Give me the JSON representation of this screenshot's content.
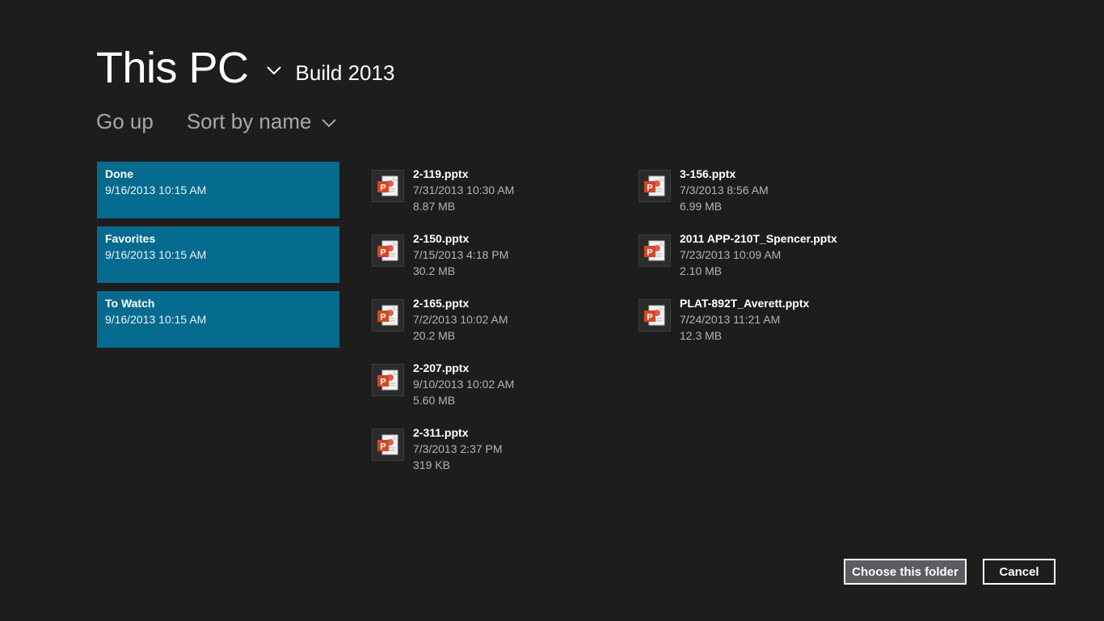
{
  "header": {
    "location": "This PC",
    "subfolder": "Build 2013",
    "location_chevron_icon": "chevron-down-icon"
  },
  "commands": {
    "go_up": "Go up",
    "sort": "Sort by name"
  },
  "folders": [
    {
      "name": "Done",
      "date": "9/16/2013 10:15 AM"
    },
    {
      "name": "Favorites",
      "date": "9/16/2013 10:15 AM"
    },
    {
      "name": "To Watch",
      "date": "9/16/2013 10:15 AM"
    }
  ],
  "files": [
    {
      "name": "2-119.pptx",
      "date": "7/31/2013 10:30 AM",
      "size": "8.87 MB",
      "icon": "powerpoint-file-icon"
    },
    {
      "name": "2-150.pptx",
      "date": "7/15/2013 4:18 PM",
      "size": "30.2 MB",
      "icon": "powerpoint-file-icon"
    },
    {
      "name": "2-165.pptx",
      "date": "7/2/2013 10:02 AM",
      "size": "20.2 MB",
      "icon": "powerpoint-file-icon"
    },
    {
      "name": "2-207.pptx",
      "date": "9/10/2013 10:02 AM",
      "size": "5.60 MB",
      "icon": "powerpoint-file-icon"
    },
    {
      "name": "2-311.pptx",
      "date": "7/3/2013 2:37 PM",
      "size": "319 KB",
      "icon": "powerpoint-file-icon"
    },
    {
      "name": "3-156.pptx",
      "date": "7/3/2013 8:56 AM",
      "size": "6.99 MB",
      "icon": "powerpoint-file-icon"
    },
    {
      "name": "2011 APP-210T_Spencer.pptx",
      "date": "7/23/2013 10:09 AM",
      "size": "2.10 MB",
      "icon": "powerpoint-file-icon"
    },
    {
      "name": "PLAT-892T_Averett.pptx",
      "date": "7/24/2013 11:21 AM",
      "size": "12.3 MB",
      "icon": "powerpoint-file-icon"
    }
  ],
  "buttons": {
    "choose": "Choose this folder",
    "cancel": "Cancel"
  },
  "colors": {
    "background": "#1d1d1d",
    "folder_tile": "#056b8e",
    "powerpoint": "#d24726",
    "choose_button": "#5c5c63"
  }
}
